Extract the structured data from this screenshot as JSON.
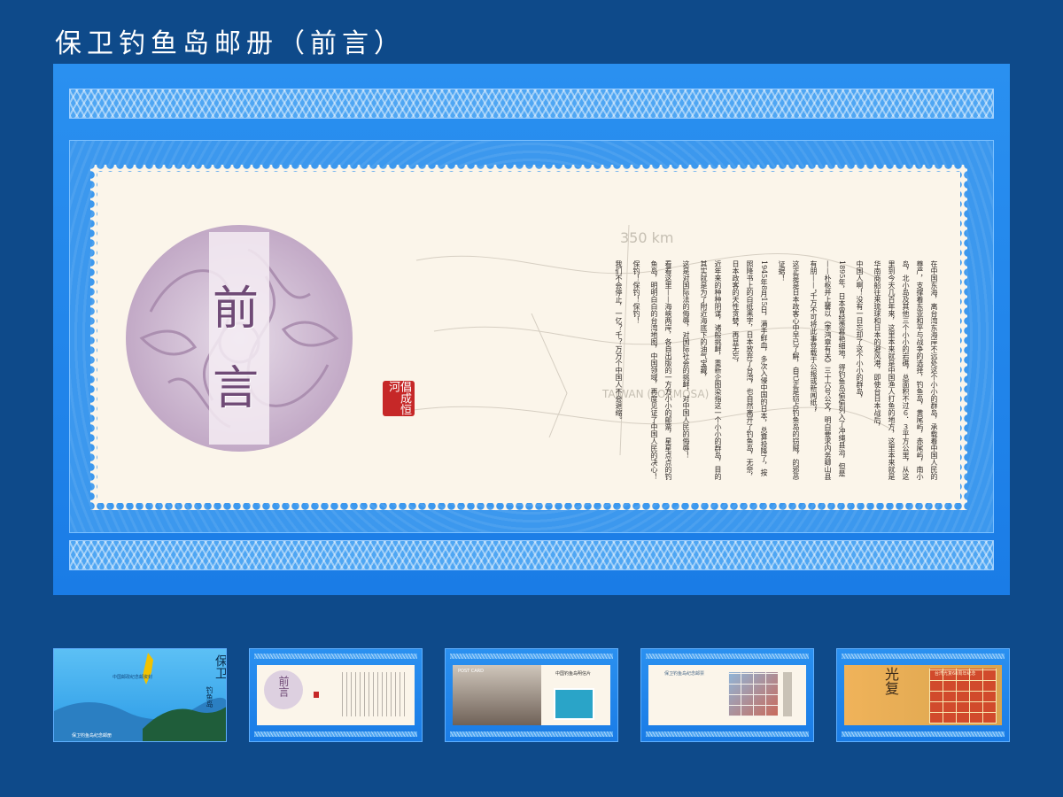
{
  "page_title": "保卫钓鱼岛邮册（前言）",
  "preface": {
    "title_char_1": "前",
    "title_char_2": "言",
    "seal_text": "倡成恒河",
    "paragraphs": [
      "在中国东海，离台湾东海岸不远处这个小小的群岛，承载着中国人民的尊严，支撑着东亚和平与战争的选择，钓鱼岛，黄尾屿，赤尾屿，南小岛，北小岛及其他三个小小的岩礁，总面积不过６．３平方公里，从这里到今天几百年来，这里本来就是中国渔人打鱼的地方，这里本来就是华南商船往来琉球和日本的避风港，即使台日本战后，",
      "中国人啊！没有一日忘却了这个小小的群岛，",
      "1895年，日本曾经羡慕艳细地，得钓鱼岛偷偷列入了冲绳县治，但是——朴枢并上馨以《李鸿章有关》三十六号公文，明白要求内务卿山县有朋——“千万不可将此事登载于公报或新闻纸”，",
      "这正是是日本政客心中早已了解，自己正是窃占钓鱼岛的窃贼，的邪恶证据！",
      "1945年8月15日，满手鲜血，多次入侵中国的日本，总算投降了，按照降书上的白纸黑字，日本放弃了台湾，也自然离开了钓鱼岛，无奈，日本政客的天性贪婪，再显无忘，",
      "近年来的种种阴谋，诸般挑衅，重新企图染指这一个小小的群岛，目的其实就是为了附近海底下的油气宝藏，",
      "这是对国际法的侮辱，对国际社会的挑衅，对中国人民的侮辱！",
      "看看这里——海峡两岸，各自出版的一方方小小的邮票，星星点点的钓鱼岛，明明白白的台湾地图，中国领域，再度见证了中国人民的决心！",
      "保钓！保钓！保钓！",
      "我们不会停止，一亿？千？万万个中国人不会退缩。"
    ]
  },
  "map_labels": {
    "distance": "350 km",
    "island": "TAIWAN (FORMOSA)"
  },
  "thumbnails": [
    {
      "name": "cover",
      "title": "保卫",
      "subtitle": "钓鱼岛",
      "caption": "保卫钓鱼岛纪念邮册",
      "banner": "中国邮政纪念邮资封"
    },
    {
      "name": "preface",
      "title": "前言"
    },
    {
      "name": "postcard",
      "postcard_label": "POST CARD",
      "heading": "中国钓鱼岛明信片"
    },
    {
      "name": "stamp-sheet",
      "heading": "保卫钓鱼岛纪念邮票"
    },
    {
      "name": "restoration",
      "title": "光复",
      "heading": "台湾光复68周年纪念"
    }
  ],
  "colors": {
    "background": "#0e4a8a",
    "panel_blue": "#1a7ce6",
    "paper": "#fbf5ea",
    "title_purple": "#6f4a76",
    "seal_red": "#c62828"
  }
}
